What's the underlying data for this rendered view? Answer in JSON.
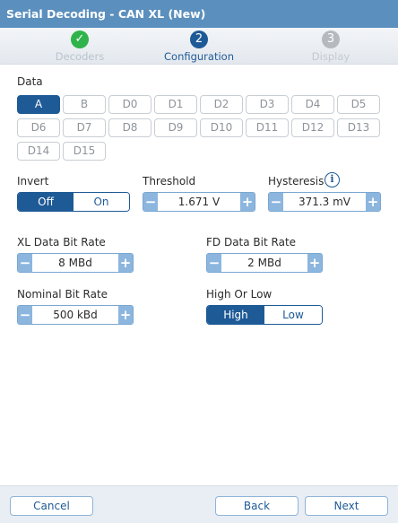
{
  "window": {
    "title": "Serial Decoding - CAN XL (New)"
  },
  "steps": [
    {
      "number": "✓",
      "label": "Decoders",
      "state": "done"
    },
    {
      "number": "2",
      "label": "Configuration",
      "state": "current"
    },
    {
      "number": "3",
      "label": "Display",
      "state": "pending"
    }
  ],
  "data": {
    "label": "Data",
    "channels": [
      "A",
      "B",
      "D0",
      "D1",
      "D2",
      "D3",
      "D4",
      "D5",
      "D6",
      "D7",
      "D8",
      "D9",
      "D10",
      "D11",
      "D12",
      "D13",
      "D14",
      "D15"
    ],
    "selected": "A"
  },
  "invert": {
    "label": "Invert",
    "options": [
      "Off",
      "On"
    ],
    "selected": "Off"
  },
  "threshold": {
    "label": "Threshold",
    "value": "1.671 V"
  },
  "hysteresis": {
    "label": "Hysteresis",
    "value": "371.3 mV",
    "info_icon": "i"
  },
  "xl_rate": {
    "label": "XL Data Bit Rate",
    "value": "8 MBd"
  },
  "fd_rate": {
    "label": "FD Data Bit Rate",
    "value": "2 MBd"
  },
  "nominal_rate": {
    "label": "Nominal Bit Rate",
    "value": "500 kBd"
  },
  "high_low": {
    "label": "High Or Low",
    "options": [
      "High",
      "Low"
    ],
    "selected": "High"
  },
  "spin": {
    "minus": "−",
    "plus": "+"
  },
  "footer": {
    "cancel": "Cancel",
    "back": "Back",
    "next": "Next"
  },
  "colors": {
    "accent": "#1e5a96",
    "title_bar": "#5b8fbd",
    "done": "#2fb34a"
  }
}
